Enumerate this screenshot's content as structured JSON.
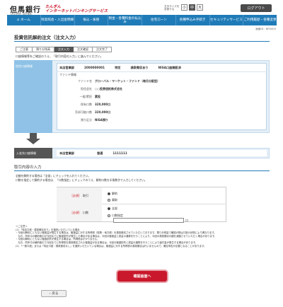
{
  "header": {
    "logo_kanji": "但馬銀行",
    "logo_en": "TAJIMA BANK",
    "service_name_1": "たんぎん",
    "service_name_2": "インターネットバンキングサービス",
    "font_size_label": "文字サイズを変更する",
    "font_sizes": [
      "小",
      "中",
      "大"
    ],
    "logout": "ログアウト"
  },
  "nav": [
    {
      "label": "ホーム"
    },
    {
      "label": "残高照会・入出金明細"
    },
    {
      "label": "振込・振替"
    },
    {
      "label": "税金・各種料金の払込み"
    },
    {
      "label": "住宅ローン"
    },
    {
      "label": "各種申込み手続き"
    },
    {
      "label": "セキュリティサービス"
    },
    {
      "label": "ご利用履歴・各種変更"
    }
  ],
  "screen_id": "画面ID：BFD405",
  "page_title": "投資信託解約注文（注文入力）",
  "steps": [
    "ご注意",
    "預り分残高",
    "注文入力",
    "注文確認",
    "注文完了"
  ],
  "active_step": 2,
  "instruction": "口座情報等をご確認のうえ、「取引内容の入力」に進んでください。",
  "order": {
    "label": "投信口座情報",
    "branch": "本店営業部",
    "account_no": "2000000001",
    "account_type": "特定",
    "tax_type": "源泉徴収あり",
    "nisa": "NISA口座開設済",
    "fund_head": "ファンド情報",
    "details": [
      {
        "key": "ファンド名",
        "value": "グローバル・マーケット・ファンド（毎月分配型）"
      },
      {
        "key": "投信会社",
        "value": "○○投資信託株式会社"
      },
      {
        "key": "一般/累投",
        "value": "累投"
      },
      {
        "key": "保有口数",
        "value": "320,000口"
      },
      {
        "key": "売却可能口数",
        "value": "320,000口"
      },
      {
        "key": "預り区分",
        "value": "NISA預り"
      }
    ]
  },
  "dest": {
    "label": "入金先口座情報",
    "branch": "本店営業部",
    "type": "普通",
    "number": "1111111"
  },
  "section_title": "取引内容の入力",
  "section_notes": [
    "全額を解約する場合は「全部」にチェックを入れてください。",
    "口数を指定して解約する場合は、「口数指定」にチェックのうえ、解約口数を半角数字で入力してください。"
  ],
  "form": {
    "required": "［必須］",
    "trade_label": "取引",
    "trade_options": [
      "解約",
      "買取"
    ],
    "qty_label": "口数",
    "qty_options": [
      "全部",
      "口数指定"
    ],
    "qty_unit": "口"
  },
  "notes": [
    "＜ご注意＞",
    "(1) 「特定口座・源泉徴収あり」を選択いただいている場合",
    "・今回の解約にともない譲渡益が発生する場合は、譲渡益に対する所得税（復興・地方税）を源泉徴収させていただいております。預り分残高で確認の際は口座の状態により異なります。",
    "　なお、同年中の解約取引が今回までに譲渡損失が発生した場合がある場合は、今回の譲渡益と損益の通算を行うことにより、今回の源泉徴収の額を減額させていただく場合があります。",
    "・今回の解約にともない譲渡損失が発生する場合は、所得税はかかりません。",
    "　なお、同年中の解約取引で今回までに所得税を源泉徴収された譲渡益がある場合は、今回の譲渡損失と損益の通算を行うことにより還付金が発生する場合があります。",
    "(2) 「一般口座」または「特定口座・源泉徴収なし」を選択いただいている場合は、譲渡益に対する所得税の源泉徴収は行いませんので、確定申告が必要となることがあります。"
  ],
  "buttons": {
    "confirm": "確認画面へ",
    "back": "戻る"
  }
}
